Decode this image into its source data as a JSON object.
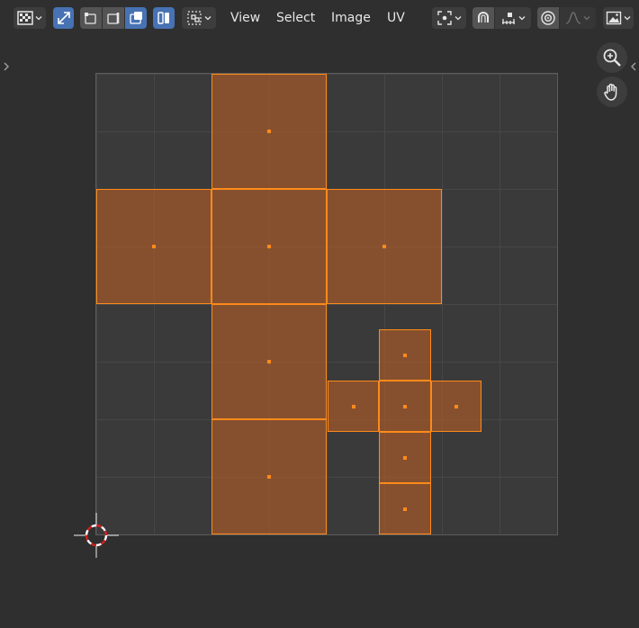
{
  "header": {
    "menus": {
      "view": "View",
      "select": "Select",
      "image": "Image",
      "uv": "UV"
    }
  },
  "icons": {
    "editor_type": "uv-editor-icon",
    "sync_selection": "sync-selection-icon",
    "select_vertex": "vertex-select-icon",
    "select_edge": "edge-select-icon",
    "select_face": "face-select-icon",
    "select_island": "island-select-icon",
    "sticky_select": "sticky-select-icon",
    "pivot": "pivot-point-icon",
    "snap": "snap-icon",
    "snap_target": "snap-target-icon",
    "proportional": "proportional-edit-icon",
    "falloff": "falloff-curve-icon",
    "image_browser": "image-icon",
    "zoom": "zoom-icon",
    "pan": "pan-hand-icon",
    "cursor": "2d-cursor-icon"
  },
  "colors": {
    "background": "#2f2f2f",
    "grid_fill": "#3a3a3a",
    "face_fill": "#b55d26",
    "face_edge": "#ff8a1a",
    "accent": "#4772b3"
  },
  "uv_faces_count": 12
}
